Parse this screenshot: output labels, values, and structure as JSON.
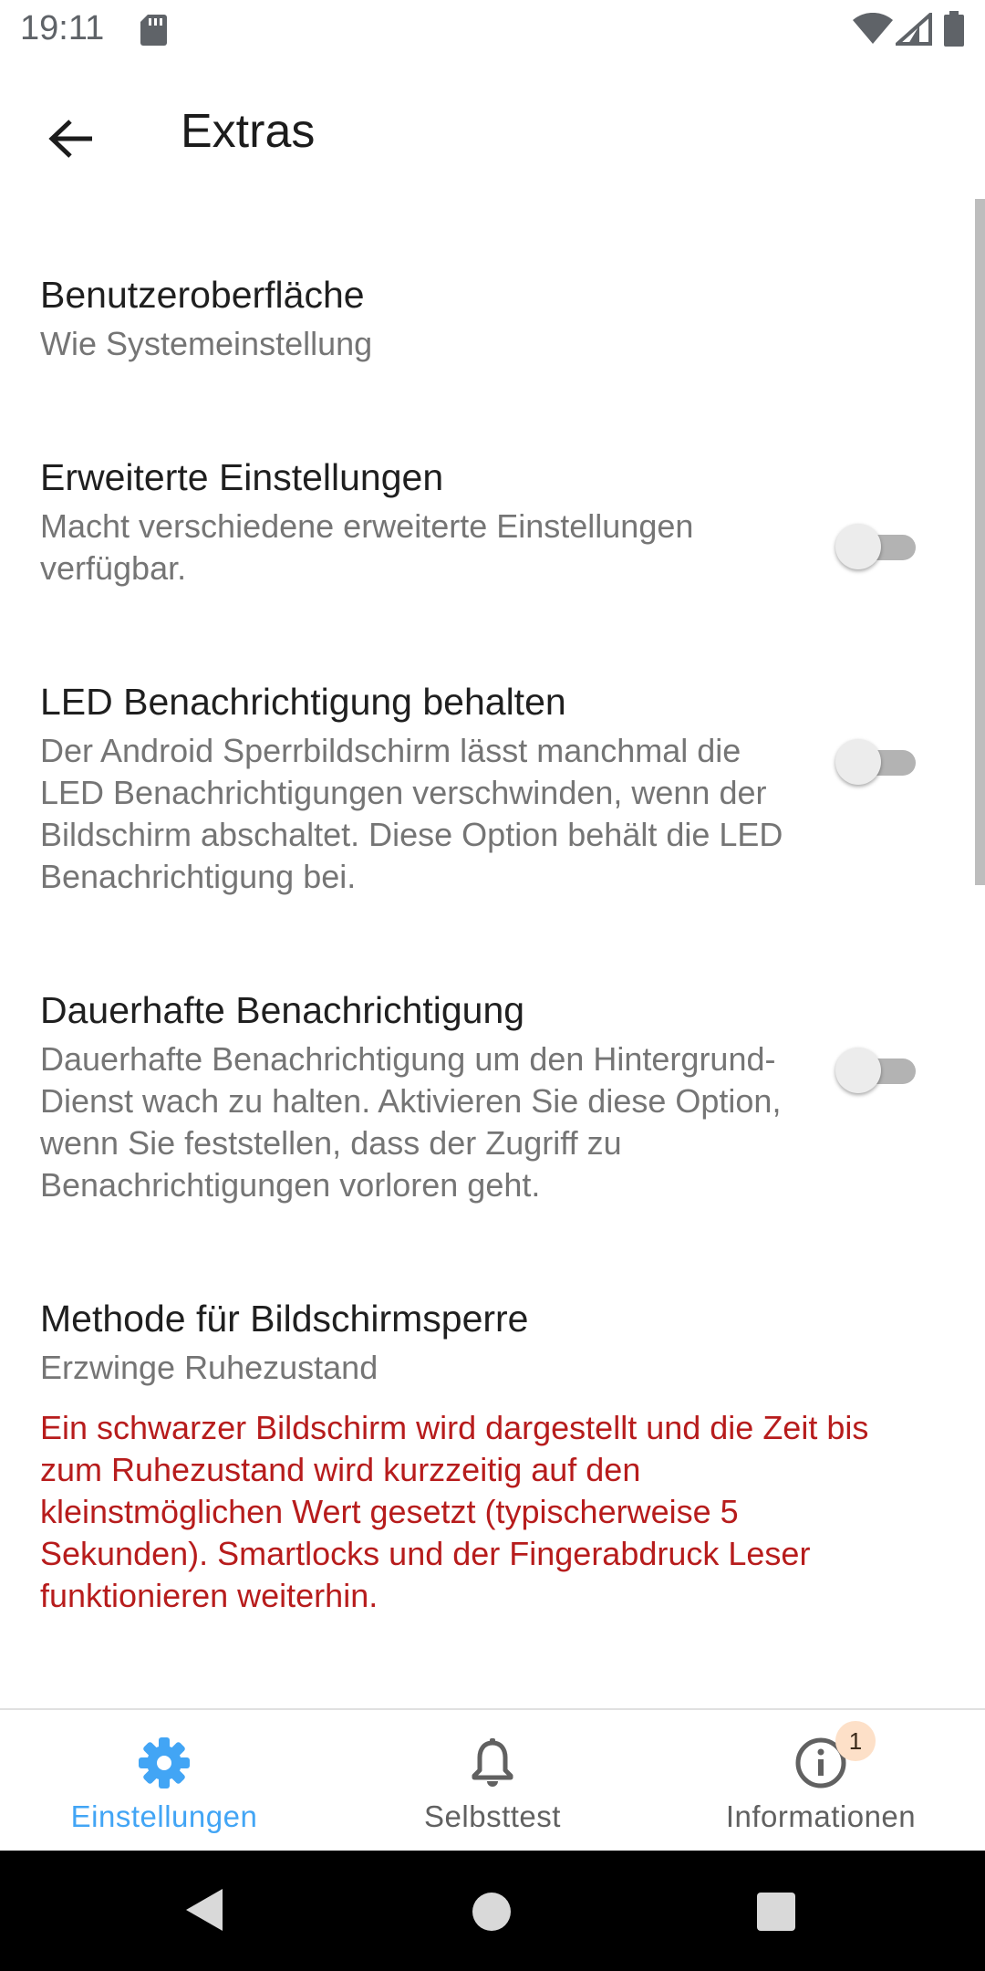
{
  "status_bar": {
    "time": "19:11",
    "icons": [
      "sd-card-icon",
      "wifi-icon",
      "signal-icon",
      "battery-icon"
    ]
  },
  "app_bar": {
    "title": "Extras",
    "back_icon": "arrow-back-icon"
  },
  "settings": [
    {
      "title": "Benutzeroberfläche",
      "summary": "Wie Systemeinstellung"
    },
    {
      "title": "Erweiterte Einstellungen",
      "summary": "Macht verschiedene erweiterte Einstellungen verfügbar.",
      "toggle": false
    },
    {
      "title": "LED Benachrichtigung behalten",
      "summary": "Der Android Sperrbildschirm lässt manchmal die LED Benachrichtigungen verschwinden, wenn der Bildschirm abschaltet. Diese Option behält die LED Benachrichtigung bei.",
      "toggle": false
    },
    {
      "title": "Dauerhafte Benachrichtigung",
      "summary": "Dauerhafte Benachrichtigung um den Hintergrund-Dienst wach zu halten. Aktivieren Sie diese Option, wenn Sie feststellen, dass der Zugriff zu Benachrichtigungen vorloren geht.",
      "toggle": false
    },
    {
      "title": "Methode für Bildschirmsperre",
      "summary": "Erzwinge Ruhezustand"
    }
  ],
  "warning": "Ein schwarzer Bildschirm wird dargestellt und die Zeit bis zum Ruhezustand wird kurzzeitig auf den kleinstmöglichen Wert gesetzt (typischerweise 5 Sekunden). Smartlocks und der Fingerabdruck Leser funktionieren weiterhin.",
  "bottom_nav": {
    "items": [
      {
        "label": "Einstellungen",
        "icon": "gear-icon",
        "active": true
      },
      {
        "label": "Selbsttest",
        "icon": "bell-icon",
        "active": false
      },
      {
        "label": "Informationen",
        "icon": "info-icon",
        "active": false,
        "badge": "1"
      }
    ]
  },
  "colors": {
    "accent": "#42a5f5",
    "warning": "#b71c1c",
    "summary": "#757575"
  }
}
